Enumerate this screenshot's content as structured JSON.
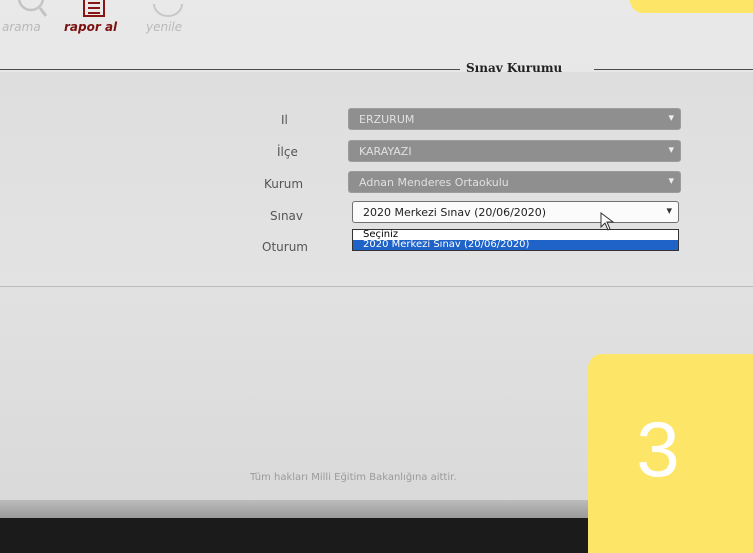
{
  "toolbar": {
    "search_label": "arama",
    "report_label": "rapor al",
    "refresh_label": "yenile"
  },
  "fieldset": {
    "legend": "Sınav Kurumu"
  },
  "form": {
    "il": {
      "label": "Il",
      "value": "ERZURUM"
    },
    "ilce": {
      "label": "İlçe",
      "value": "KARAYAZI"
    },
    "kurum": {
      "label": "Kurum",
      "value": "Adnan Menderes Ortaokulu"
    },
    "sinav": {
      "label": "Sınav",
      "value": "2020 Merkezi Sınav (20/06/2020)",
      "options": [
        "Seçiniz",
        "2020 Merkezi Sınav (20/06/2020)"
      ],
      "selected_index": 1
    },
    "oturum": {
      "label": "Oturum"
    }
  },
  "footer": {
    "text": "Tüm hakları Milli Eğitim Bakanlığına aittir."
  },
  "badge": {
    "number": "3",
    "color": "#fde567"
  },
  "colors": {
    "selection": "#1f63c9",
    "report_accent": "#7a1111"
  }
}
